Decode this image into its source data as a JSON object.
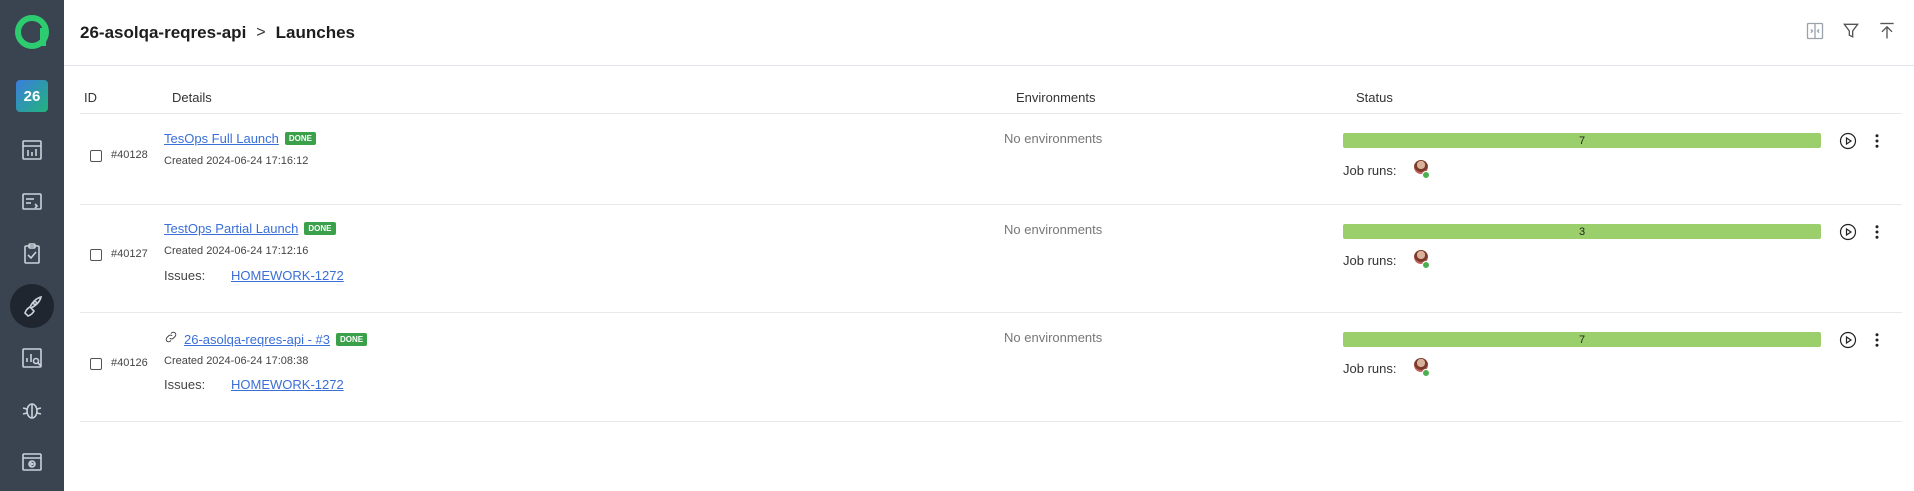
{
  "sidebar": {
    "project_badge": "26",
    "items": [
      {
        "icon": "dashboard-icon"
      },
      {
        "icon": "test-cases-icon"
      },
      {
        "icon": "test-plans-icon"
      },
      {
        "icon": "launches-rocket-icon",
        "active": true
      },
      {
        "icon": "analytics-icon"
      },
      {
        "icon": "defects-bug-icon"
      },
      {
        "icon": "jobs-icon"
      }
    ]
  },
  "header": {
    "project": "26-asolqa-reqres-api",
    "separator": ">",
    "page": "Launches"
  },
  "table": {
    "columns": {
      "id": "ID",
      "details": "Details",
      "environments": "Environments",
      "status": "Status"
    },
    "rows": [
      {
        "id": "#40128",
        "title": "TesOps Full Launch",
        "badge": "DONE",
        "created": "Created 2024-06-24 17:16:12",
        "issues_label": "",
        "issue": "",
        "environments": "No environments",
        "status_count": "7",
        "job_runs_label": "Job runs:"
      },
      {
        "id": "#40127",
        "title": "TestOps Partial Launch",
        "badge": "DONE",
        "created": "Created 2024-06-24 17:12:16",
        "issues_label": "Issues:",
        "issue": "HOMEWORK-1272",
        "environments": "No environments",
        "status_count": "3",
        "job_runs_label": "Job runs:"
      },
      {
        "id": "#40126",
        "title": "26-asolqa-reqres-api - #3",
        "badge": "DONE",
        "created": "Created 2024-06-24 17:08:38",
        "issues_label": "Issues:",
        "issue": "HOMEWORK-1272",
        "environments": "No environments",
        "status_count": "7",
        "job_runs_label": "Job runs:"
      }
    ]
  },
  "colors": {
    "sidebar_bg": "#3a4450",
    "status_passed": "#9bcf6b",
    "done_badge": "#3aa14a",
    "link": "#3a6fd8"
  }
}
